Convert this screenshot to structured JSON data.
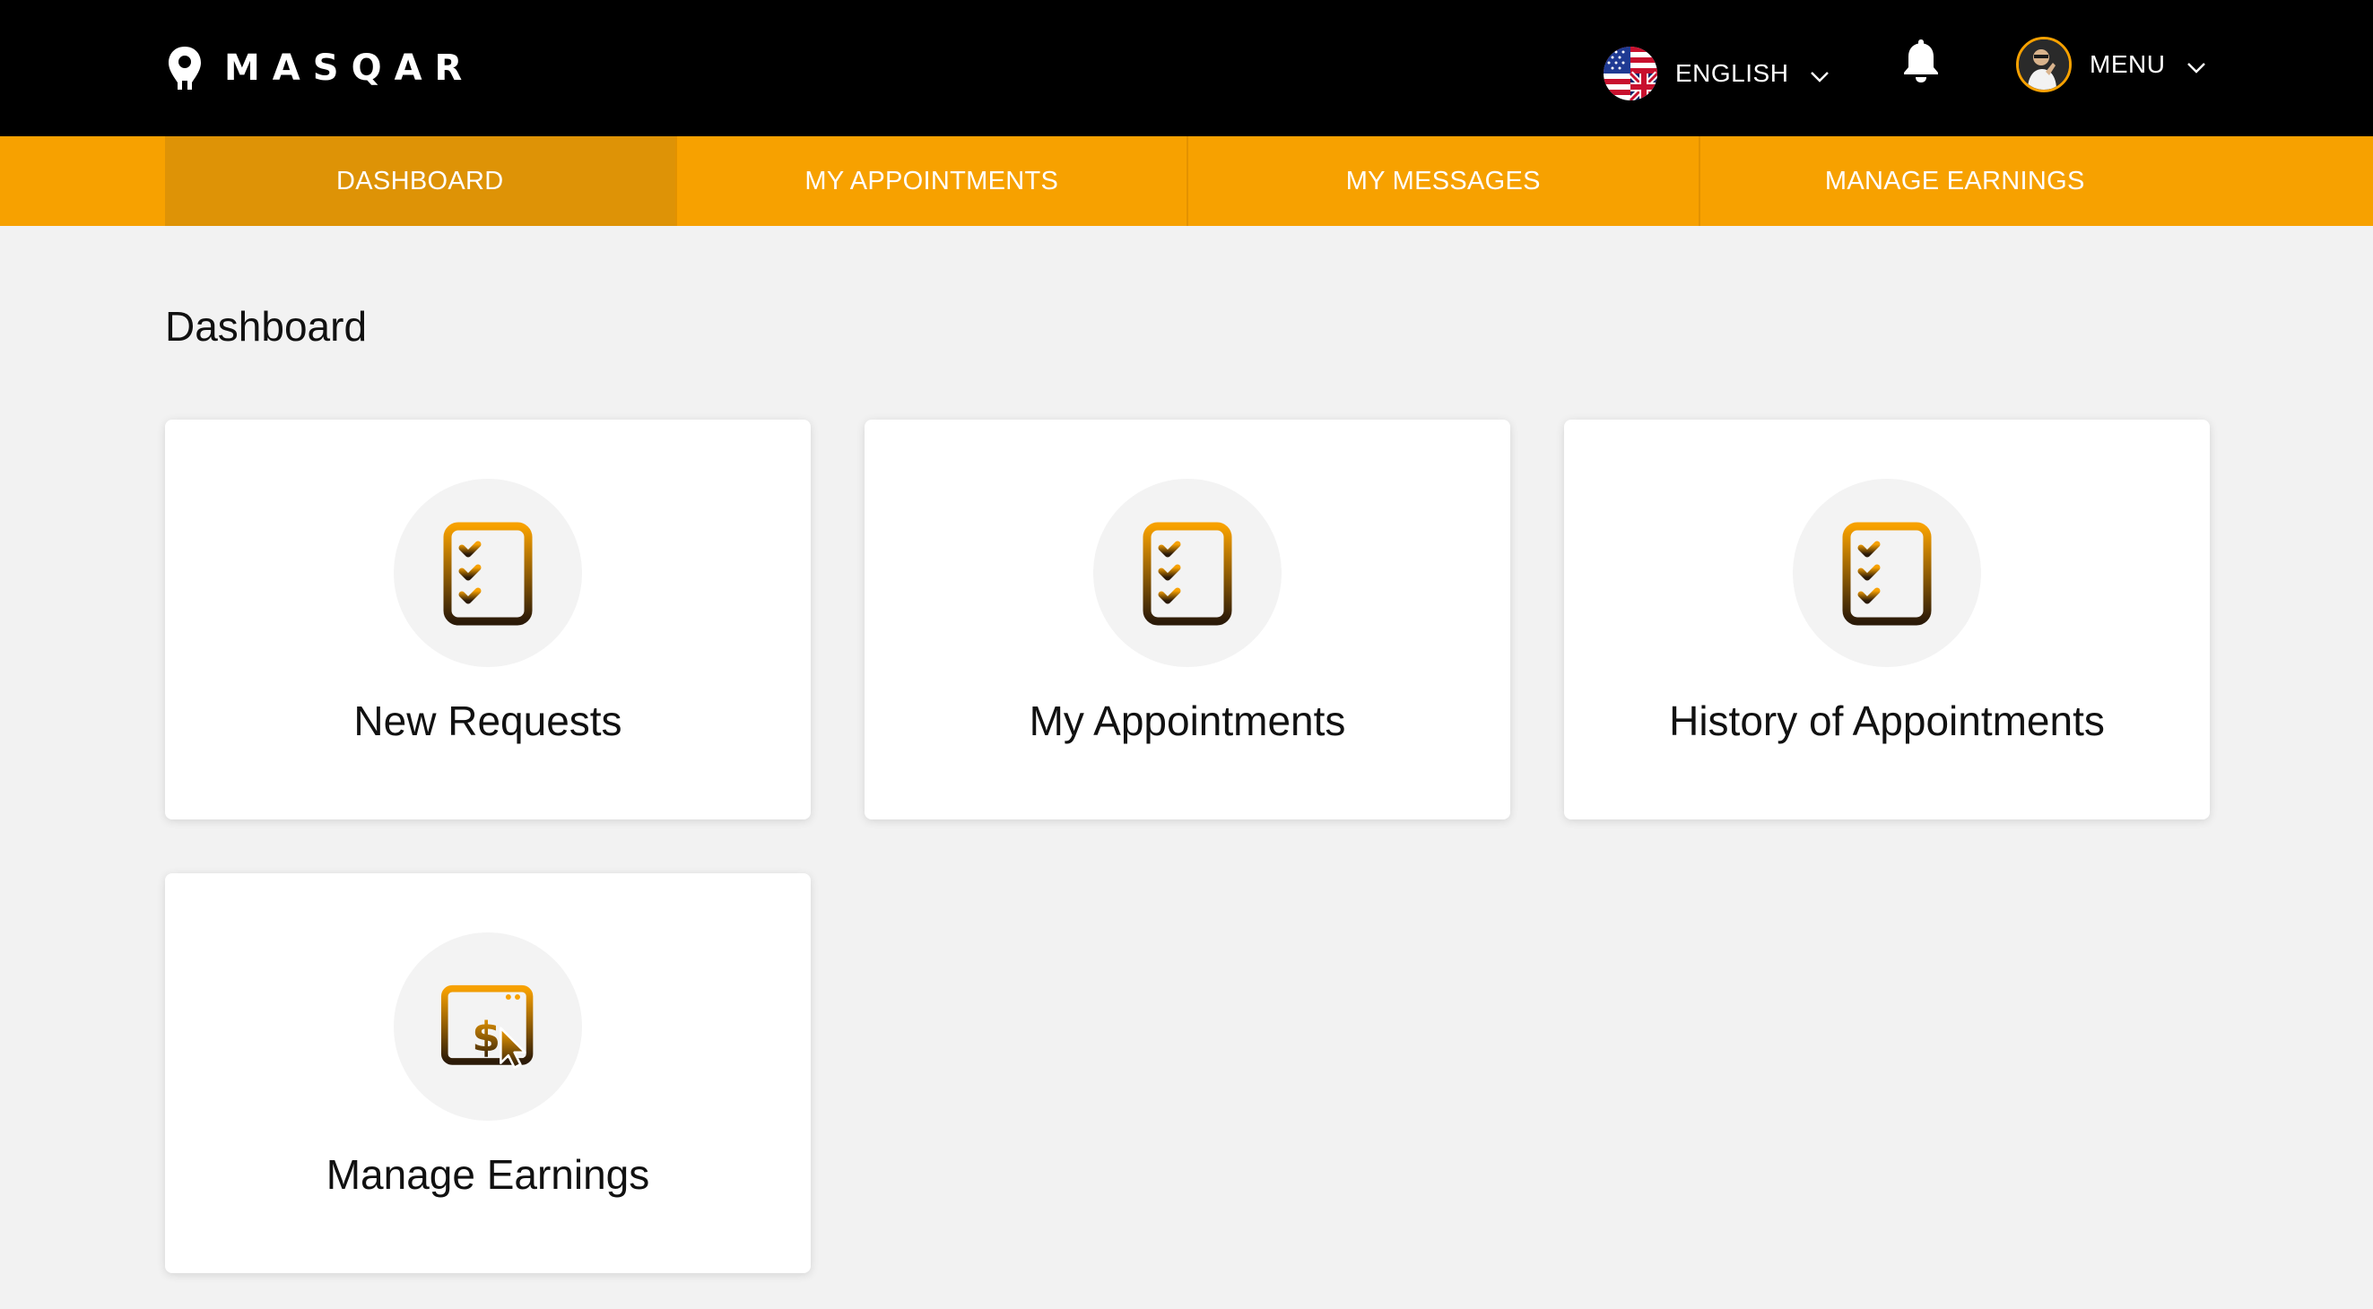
{
  "header": {
    "brand": "MASQAR",
    "language_label": "ENGLISH",
    "menu_label": "MENU",
    "icons": {
      "logo": "location-pin-logo-icon",
      "flag": "uk-us-flag-icon",
      "language_dropdown": "chevron-down-icon",
      "notifications": "bell-icon",
      "avatar": "user-avatar",
      "menu_dropdown": "chevron-down-icon"
    }
  },
  "nav": {
    "tabs": [
      {
        "label": "DASHBOARD",
        "active": true
      },
      {
        "label": "MY APPOINTMENTS",
        "active": false
      },
      {
        "label": "MY MESSAGES",
        "active": false
      },
      {
        "label": "MANAGE EARNINGS",
        "active": false
      }
    ]
  },
  "main": {
    "title": "Dashboard",
    "cards": [
      {
        "label": "New Requests",
        "icon": "checklist-icon"
      },
      {
        "label": "My Appointments",
        "icon": "checklist-icon"
      },
      {
        "label": "History of Appointments",
        "icon": "checklist-icon"
      },
      {
        "label": "Manage Earnings",
        "icon": "earnings-browser-icon"
      }
    ]
  },
  "colors": {
    "topbar": "#000000",
    "accent": "#f7a100",
    "active_tab": "#de9306",
    "page_background": "#f2f2f2",
    "card_background": "#ffffff",
    "icon_gradient_start": "#f7a100",
    "icon_gradient_end": "#2b1a08"
  }
}
